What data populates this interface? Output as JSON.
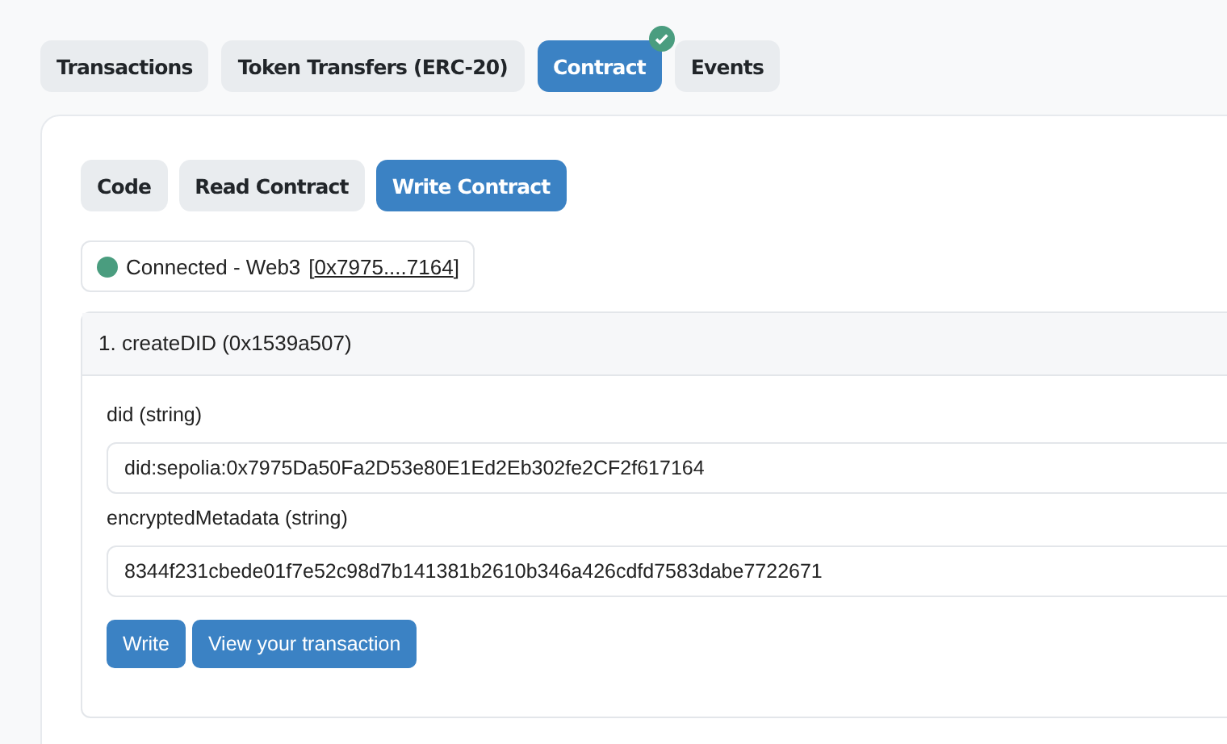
{
  "tabs": [
    {
      "label": "Transactions",
      "selected": false,
      "verified": false
    },
    {
      "label": "Token Transfers (ERC-20)",
      "selected": false,
      "verified": false
    },
    {
      "label": "Contract",
      "selected": true,
      "verified": true
    },
    {
      "label": "Events",
      "selected": false,
      "verified": false
    }
  ],
  "subtabs": [
    {
      "label": "Code",
      "selected": false
    },
    {
      "label": "Read Contract",
      "selected": false
    },
    {
      "label": "Write Contract",
      "selected": true
    }
  ],
  "connection": {
    "status": "Connected - Web3",
    "color": "#4a9d7f",
    "address_open": "[",
    "address": "0x7975....7164",
    "address_close": "]"
  },
  "function": {
    "title": "1. createDID (0x1539a507)",
    "inputs": [
      {
        "label": "did (string)",
        "value": "did:sepolia:0x7975Da50Fa2D53e80E1Ed2Eb302fe2CF2f617164"
      },
      {
        "label": "encryptedMetadata (string)",
        "value": "8344f231cbede01f7e52c98d7b141381b2610b346a426cdfd7583dabe7722671"
      }
    ],
    "buttons": [
      "Write",
      "View your transaction"
    ]
  }
}
